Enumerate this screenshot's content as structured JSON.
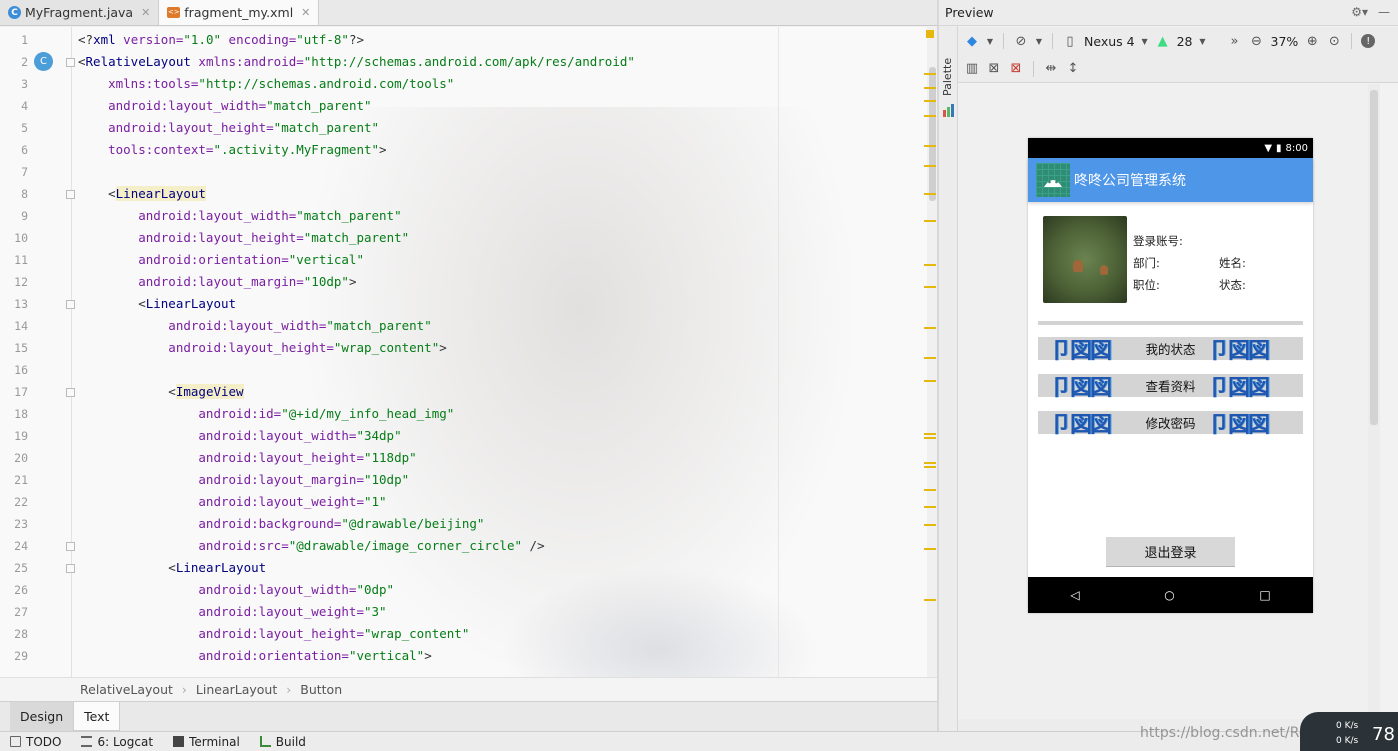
{
  "tabs": [
    {
      "label": "MyFragment.java",
      "icon": "java-class-icon",
      "active": false
    },
    {
      "label": "fragment_my.xml",
      "icon": "xml-file-icon",
      "active": true
    }
  ],
  "editor": {
    "gutter_badge": "C",
    "line_numbers": [
      "1",
      "2",
      "3",
      "4",
      "5",
      "6",
      "7",
      "8",
      "9",
      "10",
      "11",
      "12",
      "13",
      "14",
      "15",
      "16",
      "17",
      "18",
      "19",
      "20",
      "21",
      "22",
      "23",
      "24",
      "25",
      "26",
      "27",
      "28",
      "29"
    ],
    "lines": [
      [
        {
          "t": "<?",
          "c": "punct"
        },
        {
          "t": "xml ",
          "c": "tag"
        },
        {
          "t": "version=",
          "c": "attr"
        },
        {
          "t": "\"1.0\" ",
          "c": "str"
        },
        {
          "t": "encoding=",
          "c": "attr"
        },
        {
          "t": "\"utf-8\"",
          "c": "str"
        },
        {
          "t": "?>",
          "c": "punct"
        }
      ],
      [
        {
          "t": "<",
          "c": "punct"
        },
        {
          "t": "RelativeLayout ",
          "c": "tag"
        },
        {
          "t": "xmlns:android=",
          "c": "attr"
        },
        {
          "t": "\"http://schemas.android.com/apk/res/android\"",
          "c": "str"
        }
      ],
      [
        {
          "t": "    xmlns:tools=",
          "c": "attr"
        },
        {
          "t": "\"http://schemas.android.com/tools\"",
          "c": "str"
        }
      ],
      [
        {
          "t": "    android:layout_width=",
          "c": "attr"
        },
        {
          "t": "\"match_parent\"",
          "c": "str"
        }
      ],
      [
        {
          "t": "    android:layout_height=",
          "c": "attr"
        },
        {
          "t": "\"match_parent\"",
          "c": "str"
        }
      ],
      [
        {
          "t": "    tools:context=",
          "c": "attr"
        },
        {
          "t": "\".activity.MyFragment\"",
          "c": "str"
        },
        {
          "t": ">",
          "c": "punct"
        }
      ],
      [],
      [
        {
          "t": "    <",
          "c": "punct"
        },
        {
          "t": "LinearLayout",
          "c": "tagh"
        }
      ],
      [
        {
          "t": "        android:layout_width=",
          "c": "attr"
        },
        {
          "t": "\"match_parent\"",
          "c": "str"
        }
      ],
      [
        {
          "t": "        android:layout_height=",
          "c": "attr"
        },
        {
          "t": "\"match_parent\"",
          "c": "str"
        }
      ],
      [
        {
          "t": "        android:orientation=",
          "c": "attr"
        },
        {
          "t": "\"vertical\"",
          "c": "str"
        }
      ],
      [
        {
          "t": "        android:layout_margin=",
          "c": "attr"
        },
        {
          "t": "\"10dp\"",
          "c": "str"
        },
        {
          "t": ">",
          "c": "punct"
        }
      ],
      [
        {
          "t": "        <",
          "c": "punct"
        },
        {
          "t": "LinearLayout",
          "c": "tag"
        }
      ],
      [
        {
          "t": "            android:layout_width=",
          "c": "attr"
        },
        {
          "t": "\"match_parent\"",
          "c": "str"
        }
      ],
      [
        {
          "t": "            android:layout_height=",
          "c": "attr"
        },
        {
          "t": "\"wrap_content\"",
          "c": "str"
        },
        {
          "t": ">",
          "c": "punct"
        }
      ],
      [],
      [
        {
          "t": "            <",
          "c": "punct"
        },
        {
          "t": "ImageView",
          "c": "tagh"
        }
      ],
      [
        {
          "t": "                android:id=",
          "c": "attr"
        },
        {
          "t": "\"@+id/my_info_head_img\"",
          "c": "str"
        }
      ],
      [
        {
          "t": "                android:layout_width=",
          "c": "attr"
        },
        {
          "t": "\"34dp\"",
          "c": "str"
        }
      ],
      [
        {
          "t": "                android:layout_height=",
          "c": "attr"
        },
        {
          "t": "\"118dp\"",
          "c": "str"
        }
      ],
      [
        {
          "t": "                android:layout_margin=",
          "c": "attr"
        },
        {
          "t": "\"10dp\"",
          "c": "str"
        }
      ],
      [
        {
          "t": "                android:layout_weight=",
          "c": "attr"
        },
        {
          "t": "\"1\"",
          "c": "str"
        }
      ],
      [
        {
          "t": "                android:background=",
          "c": "attr"
        },
        {
          "t": "\"@drawable/beijing\"",
          "c": "str"
        }
      ],
      [
        {
          "t": "                android:src=",
          "c": "attr"
        },
        {
          "t": "\"@drawable/image_corner_circle\" ",
          "c": "str"
        },
        {
          "t": "/>",
          "c": "punct"
        }
      ],
      [
        {
          "t": "            <",
          "c": "punct"
        },
        {
          "t": "LinearLayout",
          "c": "tag"
        }
      ],
      [
        {
          "t": "                android:layout_width=",
          "c": "attr"
        },
        {
          "t": "\"0dp\"",
          "c": "str"
        }
      ],
      [
        {
          "t": "                android:layout_weight=",
          "c": "attr"
        },
        {
          "t": "\"3\"",
          "c": "str"
        }
      ],
      [
        {
          "t": "                android:layout_height=",
          "c": "attr"
        },
        {
          "t": "\"wrap_content\"",
          "c": "str"
        }
      ],
      [
        {
          "t": "                android:orientation=",
          "c": "attr"
        },
        {
          "t": "\"vertical\"",
          "c": "str"
        },
        {
          "t": ">",
          "c": "punct"
        }
      ]
    ]
  },
  "breadcrumb": [
    "RelativeLayout",
    "LinearLayout",
    "Button"
  ],
  "mode_tabs": {
    "design": "Design",
    "text": "Text"
  },
  "status_bar": {
    "todo": "TODO",
    "logcat": "6: Logcat",
    "terminal": "Terminal",
    "build": "Build"
  },
  "watermark": "https://blog.csdn.net/Roobert_Chao",
  "net_monitor": {
    "value": "78",
    "up": "0 K/s",
    "down": "0 K/s"
  },
  "preview": {
    "title": "Preview",
    "palette_label": "Palette",
    "device": "Nexus 4",
    "api": "28",
    "zoom": "37%"
  },
  "phone": {
    "time": "8:00",
    "app_title": "咚咚公司管理系统",
    "login_label": "登录账号:",
    "dept_label": "部门:",
    "name_label": "姓名:",
    "position_label": "职位:",
    "state_label": "状态:",
    "menu": [
      "我的状态",
      "查看资料",
      "修改密码"
    ],
    "deco_text": "卩図図",
    "logout": "退出登录"
  },
  "colors": {
    "appbar": "#4e96e8",
    "accent_marker": "#e4b80f"
  }
}
